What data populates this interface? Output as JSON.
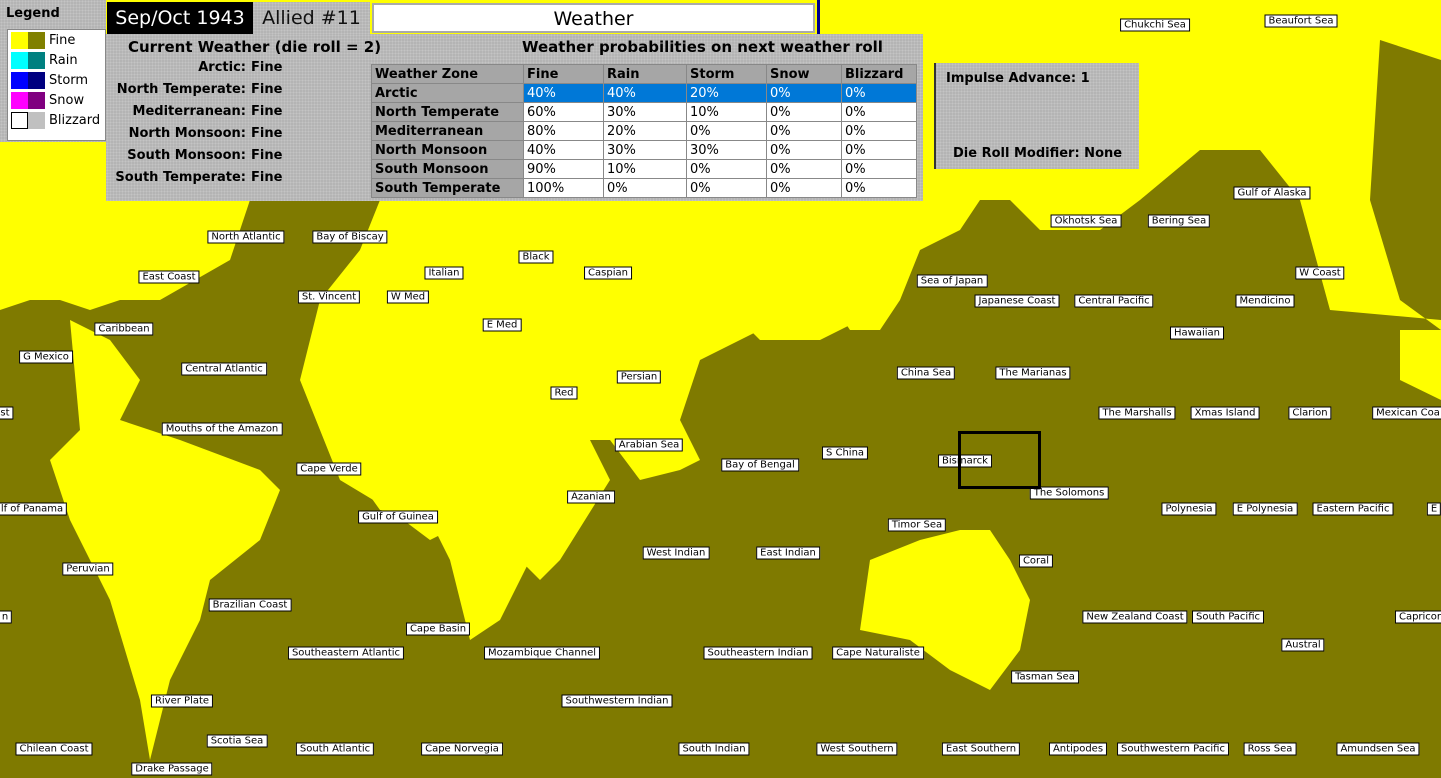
{
  "header": {
    "date": "Sep/Oct 1943",
    "turn": "Allied #11",
    "view": "Weather"
  },
  "legend": {
    "title": "Legend",
    "items": [
      {
        "label": "Fine",
        "light": "#ffff00",
        "dark": "#808000"
      },
      {
        "label": "Rain",
        "light": "#00ffff",
        "dark": "#008080"
      },
      {
        "label": "Storm",
        "light": "#0000ff",
        "dark": "#000080"
      },
      {
        "label": "Snow",
        "light": "#ff00ff",
        "dark": "#800080"
      },
      {
        "label": "Blizzard",
        "light": "#ffffff",
        "dark": "#c0c0c0"
      }
    ]
  },
  "current": {
    "title": "Current Weather (die roll = 2)",
    "zones": [
      {
        "zone": "Arctic:",
        "value": "Fine"
      },
      {
        "zone": "North Temperate:",
        "value": "Fine"
      },
      {
        "zone": "Mediterranean:",
        "value": "Fine"
      },
      {
        "zone": "North Monsoon:",
        "value": "Fine"
      },
      {
        "zone": "South Monsoon:",
        "value": "Fine"
      },
      {
        "zone": "South Temperate:",
        "value": "Fine"
      }
    ]
  },
  "probabilities": {
    "title": "Weather probabilities on next weather roll",
    "columns": [
      "Weather Zone",
      "Fine",
      "Rain",
      "Storm",
      "Snow",
      "Blizzard"
    ],
    "rows": [
      [
        "Arctic",
        "40%",
        "40%",
        "20%",
        "0%",
        "0%"
      ],
      [
        "North Temperate",
        "60%",
        "30%",
        "10%",
        "0%",
        "0%"
      ],
      [
        "Mediterranean",
        "80%",
        "20%",
        "0%",
        "0%",
        "0%"
      ],
      [
        "North Monsoon",
        "40%",
        "30%",
        "30%",
        "0%",
        "0%"
      ],
      [
        "South Monsoon",
        "90%",
        "10%",
        "0%",
        "0%",
        "0%"
      ],
      [
        "South Temperate",
        "100%",
        "0%",
        "0%",
        "0%",
        "0%"
      ]
    ],
    "selected_row": 0
  },
  "impulse": {
    "advance": "Impulse Advance:  1",
    "modifier": "Die Roll Modifier:  None"
  },
  "map": {
    "colors": {
      "land": "#ffff00",
      "sea": "#7f7a00"
    },
    "labels": [
      "Chukchi Sea",
      "Beaufort Sea",
      "Gulf of Alaska",
      "Okhotsk Sea",
      "Bering Sea",
      "W Coast",
      "North Atlantic",
      "Bay of Biscay",
      "Black",
      "Caspian",
      "Italian",
      "Sea of Japan",
      "St. Vincent",
      "W Med",
      "Japanese Coast",
      "Central Pacific",
      "Mendicino",
      "East Coast",
      "Caribbean",
      "E Med",
      "Hawaiian",
      "G Mexico",
      "Central Atlantic",
      "Persian",
      "China Sea",
      "The Marianas",
      "Red",
      "st",
      "The Marshalls",
      "Xmas Island",
      "Clarion",
      "Mexican Coa",
      "Mouths of the Amazon",
      "Arabian Sea",
      "S China",
      "Bay of Bengal",
      "Bismarck",
      "Cape Verde",
      "The Solomons",
      "Azanian",
      "lf of Panama",
      "Gulf of Guinea",
      "Polynesia",
      "E Polynesia",
      "Eastern Pacific",
      "E",
      "Timor Sea",
      "West Indian",
      "East Indian",
      "Coral",
      "Peruvian",
      "Brazilian Coast",
      "n",
      "New Zealand Coast",
      "South Pacific",
      "Capricor",
      "Cape Basin",
      "Austral",
      "Southeastern Atlantic",
      "Mozambique Channel",
      "Southeastern Indian",
      "Cape Naturaliste",
      "Tasman Sea",
      "River Plate",
      "Southwestern Indian",
      "Scotia Sea",
      "Chilean Coast",
      "South Atlantic",
      "Cape Norvegia",
      "South Indian",
      "West Southern",
      "East Southern",
      "Antipodes",
      "Southwestern Pacific",
      "Ross Sea",
      "Amundsen Sea",
      "Drake Passage"
    ]
  }
}
